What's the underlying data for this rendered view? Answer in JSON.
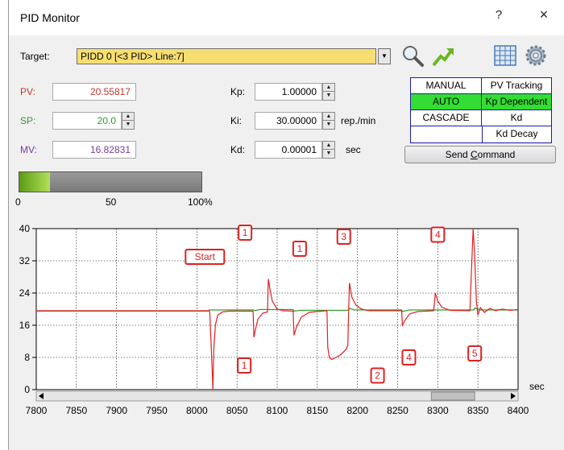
{
  "window": {
    "title": "PID Monitor",
    "help_label": "?",
    "close_label": "×"
  },
  "target": {
    "label": "Target:",
    "value": "PIDD 0 [<3 PID> Line:7]"
  },
  "fields": {
    "pv": {
      "label": "PV:",
      "value": "20.55817",
      "color": "#c0392b"
    },
    "sp": {
      "label": "SP:",
      "value": "20.0",
      "color": "#2e9b2e"
    },
    "mv": {
      "label": "MV:",
      "value": "16.82831",
      "color": "#7a3c9a"
    },
    "kp": {
      "label": "Kp:",
      "value": "1.00000"
    },
    "ki": {
      "label": "Ki:",
      "value": "30.00000",
      "unit": "rep./min"
    },
    "kd": {
      "label": "Kd:",
      "value": "0.00001",
      "unit": "sec"
    }
  },
  "modes": {
    "manual": "MANUAL",
    "auto": "AUTO",
    "cascade": "CASCADE",
    "pv_tracking": "PV Tracking",
    "kp_dependent": "Kp Dependent",
    "kd": "Kd",
    "kd_decay": "Kd Decay",
    "active_color": "#33dd33"
  },
  "send_command": {
    "before": "Send ",
    "underline": "C",
    "after": "ommand"
  },
  "progress": {
    "fraction": 0.17,
    "ticks": [
      "0",
      "50",
      "100%"
    ]
  },
  "icons": [
    "search-icon",
    "trend-up-icon",
    "grid-icon",
    "gear-icon"
  ],
  "chart_data": {
    "type": "line",
    "xunit": "sec",
    "xlim": [
      7800,
      8400
    ],
    "ylim": [
      0,
      40
    ],
    "x_ticks": [
      7800,
      7850,
      7900,
      7950,
      8000,
      8050,
      8100,
      8150,
      8200,
      8250,
      8300,
      8350,
      8400
    ],
    "y_ticks": [
      0,
      8,
      16,
      24,
      32,
      40
    ],
    "grid": true,
    "series": [
      {
        "color": "#2f9e2f",
        "points": [
          [
            7800,
            19.5
          ],
          [
            8014,
            19.5
          ],
          [
            8015,
            19.8
          ],
          [
            8071,
            19.8
          ],
          [
            8072,
            19.6
          ],
          [
            8078,
            19.9
          ],
          [
            8120,
            19.9
          ],
          [
            8121,
            19.5
          ],
          [
            8128,
            19.7
          ],
          [
            8189,
            19.7
          ],
          [
            8190,
            20.2
          ],
          [
            8196,
            19.8
          ],
          [
            8255,
            19.8
          ],
          [
            8256,
            19.4
          ],
          [
            8264,
            19.8
          ],
          [
            8345,
            19.8
          ],
          [
            8346,
            20.3
          ],
          [
            8352,
            19.8
          ],
          [
            8400,
            19.8
          ]
        ]
      },
      {
        "color": "#e02020",
        "points": [
          [
            7800,
            19.6
          ],
          [
            8015,
            19.6
          ],
          [
            8016,
            19.4
          ],
          [
            8018,
            10
          ],
          [
            8019,
            5
          ],
          [
            8020,
            0
          ],
          [
            8021,
            10
          ],
          [
            8023,
            16
          ],
          [
            8026,
            18.5
          ],
          [
            8032,
            19.3
          ],
          [
            8040,
            19.5
          ],
          [
            8070,
            19.5
          ],
          [
            8071,
            13
          ],
          [
            8073,
            15
          ],
          [
            8076,
            17.5
          ],
          [
            8082,
            19
          ],
          [
            8088,
            19.3
          ],
          [
            8089,
            27.5
          ],
          [
            8091,
            25
          ],
          [
            8094,
            22
          ],
          [
            8100,
            20
          ],
          [
            8108,
            19.6
          ],
          [
            8120,
            19.5
          ],
          [
            8121,
            13.5
          ],
          [
            8124,
            15.5
          ],
          [
            8130,
            18
          ],
          [
            8140,
            19.2
          ],
          [
            8150,
            19.4
          ],
          [
            8162,
            19.6
          ],
          [
            8163,
            10.5
          ],
          [
            8165,
            8
          ],
          [
            8168,
            7.5
          ],
          [
            8178,
            8.5
          ],
          [
            8186,
            10
          ],
          [
            8188,
            11
          ],
          [
            8189,
            19.6
          ],
          [
            8190,
            26.5
          ],
          [
            8193,
            23
          ],
          [
            8198,
            21
          ],
          [
            8205,
            20
          ],
          [
            8215,
            19.6
          ],
          [
            8255,
            19.6
          ],
          [
            8256,
            16
          ],
          [
            8260,
            17.5
          ],
          [
            8265,
            18.8
          ],
          [
            8275,
            19.4
          ],
          [
            8295,
            19.6
          ],
          [
            8297,
            24
          ],
          [
            8300,
            22
          ],
          [
            8305,
            20.5
          ],
          [
            8315,
            19.7
          ],
          [
            8340,
            19.6
          ],
          [
            8344,
            40
          ],
          [
            8346,
            33
          ],
          [
            8348,
            22
          ],
          [
            8350,
            18.5
          ],
          [
            8353,
            20.4
          ],
          [
            8358,
            19.2
          ],
          [
            8365,
            20.2
          ],
          [
            8372,
            19.6
          ],
          [
            8380,
            20
          ],
          [
            8390,
            19.7
          ],
          [
            8400,
            19.9
          ]
        ]
      }
    ],
    "annotations": [
      {
        "text": "Start",
        "x": 8010,
        "y": 33
      },
      {
        "text": "1",
        "x": 8060,
        "y": 39
      },
      {
        "text": "1",
        "x": 8128,
        "y": 35
      },
      {
        "text": "3",
        "x": 8183,
        "y": 38
      },
      {
        "text": "4",
        "x": 8300,
        "y": 38.5
      },
      {
        "text": "1",
        "x": 8059,
        "y": 6
      },
      {
        "text": "2",
        "x": 8225,
        "y": 3.5
      },
      {
        "text": "4",
        "x": 8264,
        "y": 8
      },
      {
        "text": "5",
        "x": 8346,
        "y": 9
      }
    ]
  }
}
